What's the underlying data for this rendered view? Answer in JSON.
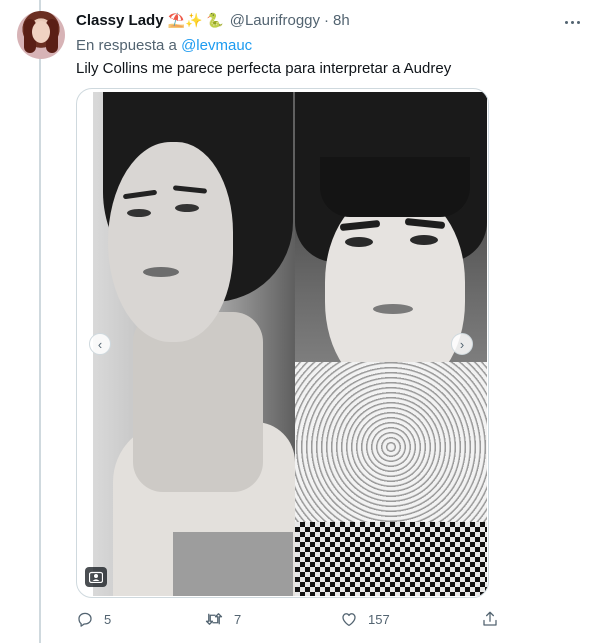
{
  "tweet": {
    "display_name": "Classy Lady",
    "name_emojis": "⛱️✨ 🐍",
    "handle": "@Laurifroggy",
    "separator": "·",
    "time": "8h",
    "reply_prefix": "En respuesta a",
    "reply_mention": "@levmauc",
    "text": "Lily Collins me parece perfecta para interpretar a Audrey"
  },
  "media": {
    "prev_glyph": "‹",
    "next_glyph": "›"
  },
  "actions": {
    "reply_count": "5",
    "retweet_count": "7",
    "like_count": "157"
  },
  "colors": {
    "accent": "#1d9bf0",
    "secondary_text": "#536471",
    "primary_text": "#0f1419",
    "border": "#cfd9de"
  },
  "icons": [
    "more-icon",
    "reply-icon",
    "retweet-icon",
    "like-icon",
    "share-icon",
    "tag-people-icon",
    "chevron-left-icon",
    "chevron-right-icon"
  ]
}
